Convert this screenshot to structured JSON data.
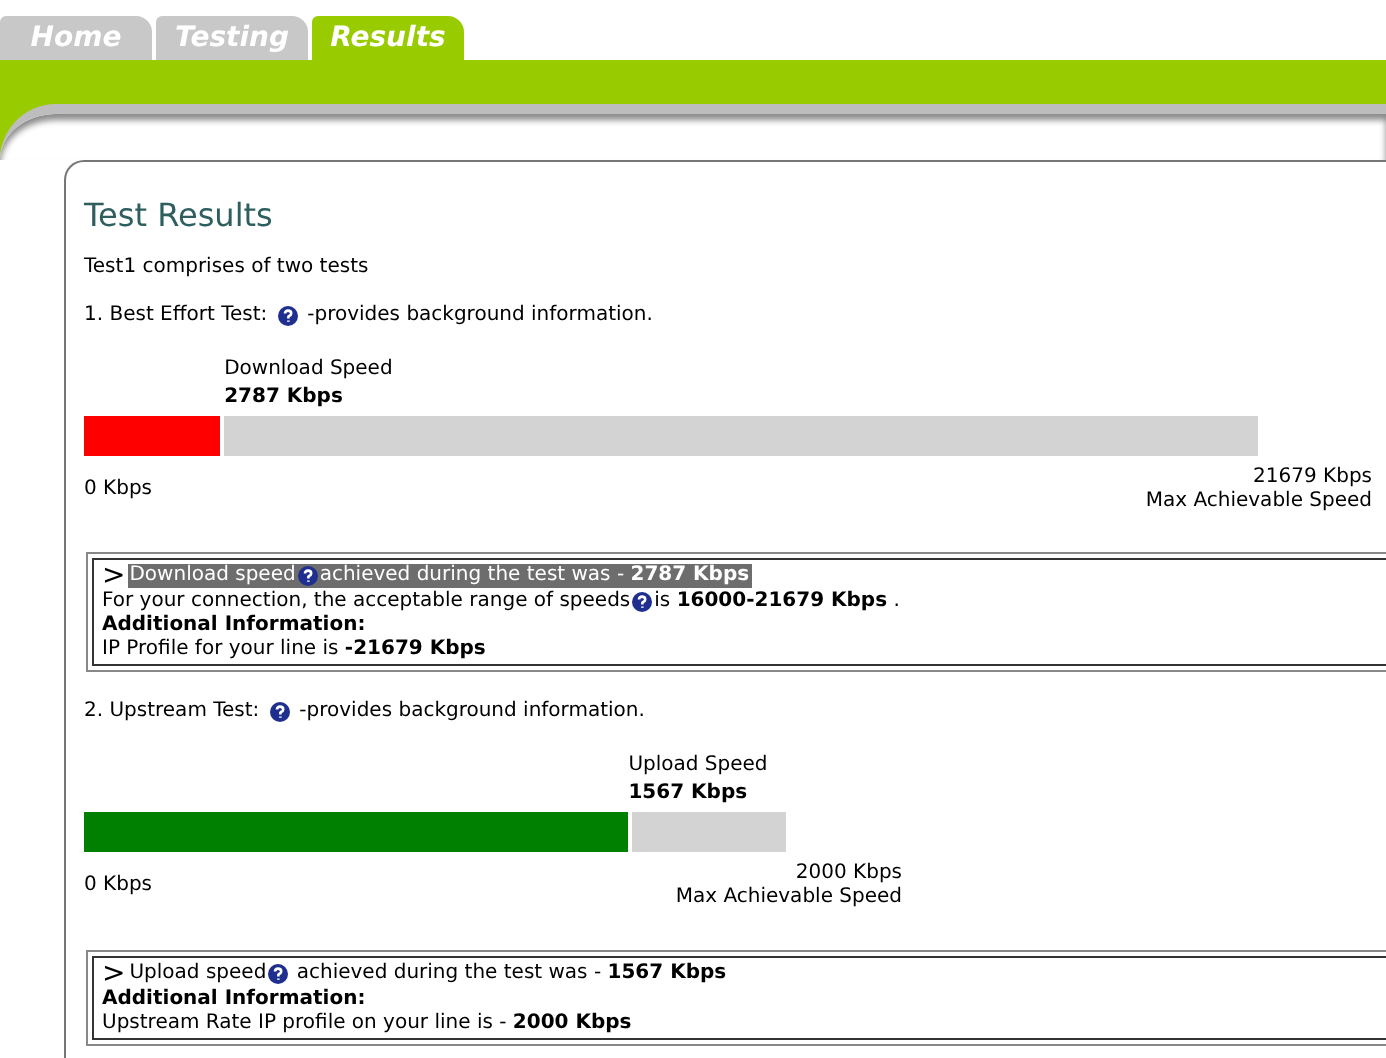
{
  "tabs": [
    {
      "label": "Home",
      "selected": false
    },
    {
      "label": "Testing",
      "selected": false
    },
    {
      "label": "Results",
      "selected": true
    }
  ],
  "title": "Test Results",
  "intro": "Test1 comprises of two tests",
  "tests": [
    {
      "heading": "1. Best Effort Test:",
      "heading_note": "-provides background information.",
      "speed_label": "Download Speed",
      "speed_value": "2787 Kbps",
      "level": 0.12,
      "color": "#ff0000",
      "min_label": "0 Kbps",
      "max_value": "21679 Kbps",
      "max_label": "Max Achievable Speed",
      "summary": {
        "arrow": ">",
        "highlighted": true,
        "lead": "Download speed",
        "rest": "achieved during the test was - **2787 Kbps**",
        "lines": [
          {
            "text": "For your connection, the acceptable range of speeds",
            "help": true,
            "text_after": "is **16000-21679 Kbps** ."
          },
          {
            "text": "Additional Information:",
            "bold": true
          },
          {
            "text": "IP Profile for your line is **-21679 Kbps**"
          }
        ]
      }
    },
    {
      "heading": "2. Upstream Test:",
      "heading_note": "-provides background information.",
      "speed_label": "Upload Speed",
      "speed_value": "1567 Kbps",
      "level": 0.78,
      "color": "#008000",
      "min_label": "0 Kbps",
      "max_value": "2000 Kbps",
      "max_label": "Max Achievable Speed",
      "summary": {
        "arrow": ">",
        "highlighted": false,
        "lead": "Upload speed",
        "rest": " achieved during the test was - **1567 Kbps**",
        "lines": [
          {
            "text": "Additional Information:",
            "bold": true
          },
          {
            "text": "Upstream Rate IP profile on your line is - **2000 Kbps**"
          }
        ]
      }
    }
  ]
}
